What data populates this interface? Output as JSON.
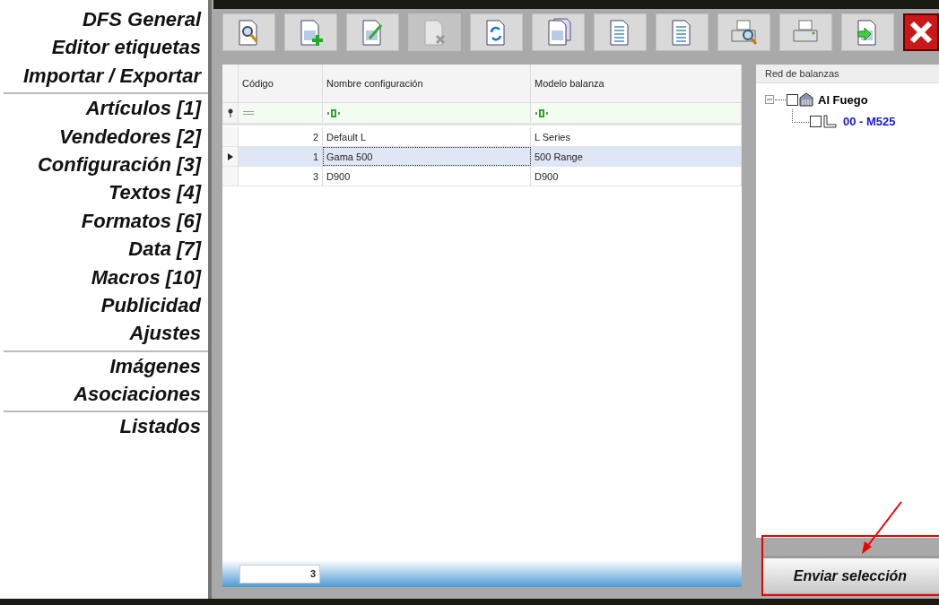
{
  "sidebar": {
    "groups": [
      [
        {
          "label": "DFS General"
        },
        {
          "label": "Editor etiquetas"
        },
        {
          "label": "Importar / Exportar"
        }
      ],
      [
        {
          "label": "Artículos [1]"
        },
        {
          "label": "Vendedores [2]"
        },
        {
          "label": "Configuración [3]"
        },
        {
          "label": "Textos [4]"
        },
        {
          "label": "Formatos [6]"
        },
        {
          "label": "Data [7]"
        },
        {
          "label": "Macros [10]"
        },
        {
          "label": "Publicidad"
        },
        {
          "label": "Ajustes"
        }
      ],
      [
        {
          "label": "Imágenes"
        },
        {
          "label": "Asociaciones"
        }
      ],
      [
        {
          "label": "Listados"
        }
      ]
    ]
  },
  "toolbar": [
    {
      "kind": "view",
      "disabled": false
    },
    {
      "kind": "add",
      "disabled": false
    },
    {
      "kind": "edit",
      "disabled": false
    },
    {
      "kind": "delete",
      "disabled": true
    },
    {
      "kind": "refresh",
      "disabled": false
    },
    {
      "kind": "copy",
      "disabled": false
    },
    {
      "kind": "tree",
      "disabled": false
    },
    {
      "kind": "list",
      "disabled": false
    },
    {
      "kind": "preview",
      "disabled": false
    },
    {
      "kind": "print",
      "disabled": false
    },
    {
      "kind": "export",
      "disabled": false
    },
    {
      "kind": "close",
      "disabled": false
    }
  ],
  "table": {
    "columns": [
      "Código",
      "Nombre configuración",
      "Modelo balanza"
    ],
    "rows": [
      {
        "cells": [
          "2",
          "Default L",
          "L Series"
        ],
        "selected": false
      },
      {
        "cells": [
          "1",
          "Gama 500",
          "500 Range"
        ],
        "selected": true
      },
      {
        "cells": [
          "3",
          "D900",
          "D900"
        ],
        "selected": false
      }
    ],
    "count": "3"
  },
  "network": {
    "title": "Red de balanzas",
    "nodes": [
      {
        "label": "Al Fuego",
        "checked": false,
        "expanded": true,
        "children": [
          {
            "label": "00 - M525",
            "checked": false
          }
        ]
      }
    ]
  },
  "send_button": "Enviar selección"
}
